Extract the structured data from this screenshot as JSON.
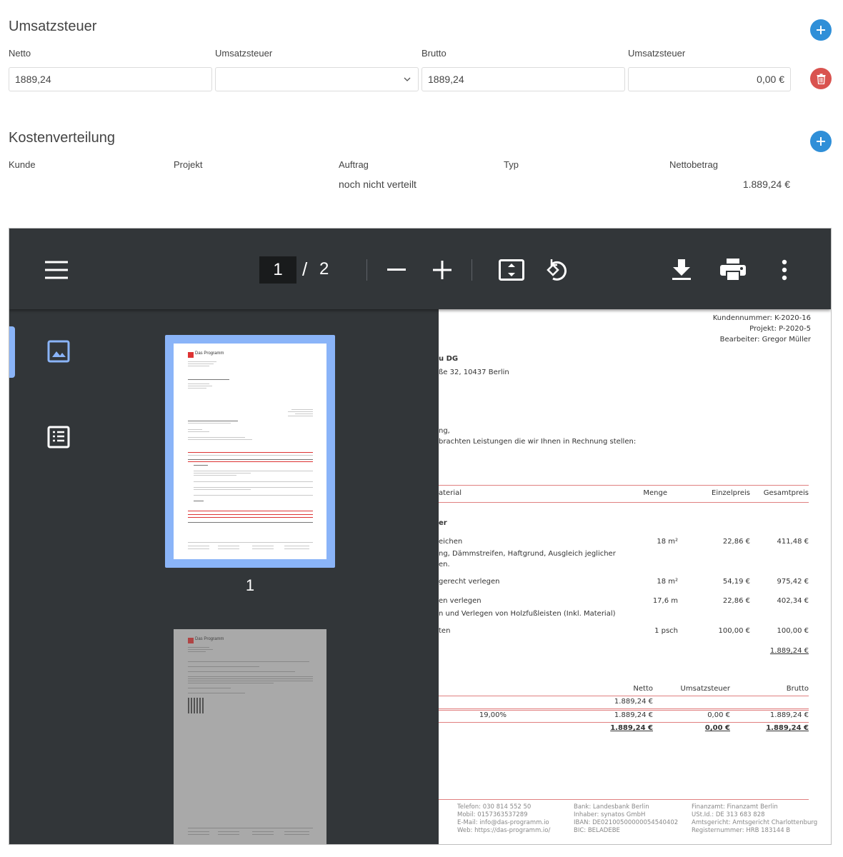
{
  "umsatzsteuer": {
    "title": "Umsatzsteuer",
    "labels": {
      "netto": "Netto",
      "ust_select": "Umsatzsteuer",
      "brutto": "Brutto",
      "ust_amount": "Umsatzsteuer"
    },
    "netto_value": "1889,24",
    "ust_select_value": "",
    "brutto_value": "1889,24",
    "ust_amount_value": "0,00 €"
  },
  "kostenverteilung": {
    "title": "Kostenverteilung",
    "headers": [
      "Kunde",
      "Projekt",
      "Auftrag",
      "Typ",
      "Nettobetrag"
    ],
    "row": {
      "auftrag": "noch nicht verteilt",
      "nettobetrag": "1.889,24 €"
    }
  },
  "viewer": {
    "current_page": "1",
    "separator": "/",
    "total_pages": "2",
    "thumbnail_1_label": "1",
    "thumb_brand": "Das Programm",
    "toolbar_bg": "#323639",
    "accent": "#8ab4f8"
  },
  "document": {
    "info": [
      "Kundennummer: K-2020-16",
      "Projekt: P-2020-5",
      "Bearbeiter: Gregor Müller"
    ],
    "recipient_name": "u DG",
    "recipient_street": "ße 32, 10437 Berlin",
    "salutation": "ng,",
    "intro": "brachten Leistungen die wir Ihnen in Rechnung stellen:",
    "table_headers": {
      "material": "aterial",
      "menge": "Menge",
      "einzelpreis": "Einzelpreis",
      "gesamtpreis": "Gesamtpreis"
    },
    "group_label": "er",
    "items": [
      {
        "desc": "eichen",
        "sub": "ng, Dämmstreifen, Haftgrund, Ausgleich jeglicher",
        "sub2": "en.",
        "menge": "18 m²",
        "einzel": "22,86 €",
        "gesamt": "411,48 €"
      },
      {
        "desc": "gerecht verlegen",
        "sub": "",
        "sub2": "",
        "menge": "18 m²",
        "einzel": "54,19 €",
        "gesamt": "975,42 €"
      },
      {
        "desc": "en verlegen",
        "sub": "n und Verlegen von Holzfußleisten (Inkl. Material)",
        "sub2": "",
        "menge": "17,6 m",
        "einzel": "22,86 €",
        "gesamt": "402,34 €"
      },
      {
        "desc": "ten",
        "sub": "",
        "sub2": "",
        "menge": "1 psch",
        "einzel": "100,00 €",
        "gesamt": "100,00 €"
      }
    ],
    "subtotal": "1.889,24 €",
    "tax_headers": {
      "netto": "Netto",
      "ust": "Umsatzsteuer",
      "brutto": "Brutto"
    },
    "tax_row1_netto": "1.889,24 €",
    "tax_row2": {
      "rate": "19,00%",
      "netto": "1.889,24 €",
      "ust": "0,00 €",
      "brutto": "1.889,24 €"
    },
    "tax_total": {
      "netto": "1.889,24 €",
      "ust": "0,00 €",
      "brutto": "1.889,24 €"
    },
    "footer": {
      "col1": [
        "Telefon: 030 814 552 50",
        "Mobil: 0157363537289",
        "E-Mail: info@das-programm.io",
        "Web: https://das-programm.io/"
      ],
      "col2": [
        "Bank: Landesbank Berlin",
        "Inhaber: synatos GmbH",
        "IBAN: DE02100500000054540402",
        "BIC: BELADEBE"
      ],
      "col3": [
        "Finanzamt: Finanzamt Berlin",
        "USt.Id.: DE 313 683 828",
        "Amtsgericht: Amtsgericht Charlottenburg",
        "Registernummer: HRB 183144 B"
      ]
    }
  }
}
